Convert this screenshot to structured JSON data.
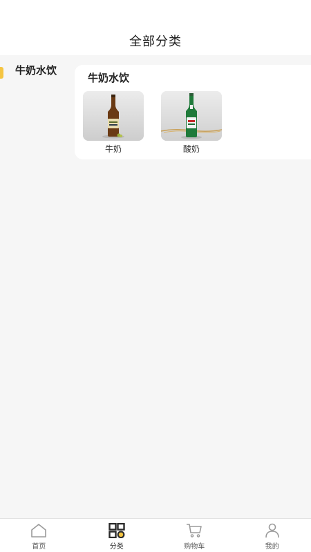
{
  "header": {
    "title": "全部分类"
  },
  "sidebar": {
    "items": [
      {
        "label": "牛奶水饮",
        "active": true
      }
    ],
    "accent_color": "#f5c542"
  },
  "category_panel": {
    "title": "牛奶水饮",
    "products": [
      {
        "name": "牛奶",
        "image": "amber-bottle-icon"
      },
      {
        "name": "酸奶",
        "image": "green-bottle-icon"
      }
    ]
  },
  "tabbar": {
    "tabs": [
      {
        "label": "首页",
        "icon": "home-icon",
        "active": false
      },
      {
        "label": "分类",
        "icon": "category-icon",
        "active": true
      },
      {
        "label": "购物车",
        "icon": "cart-icon",
        "active": false
      },
      {
        "label": "我的",
        "icon": "user-icon",
        "active": false
      }
    ],
    "active_color": "#2b2b2b",
    "inactive_color": "#9a9a9a"
  }
}
